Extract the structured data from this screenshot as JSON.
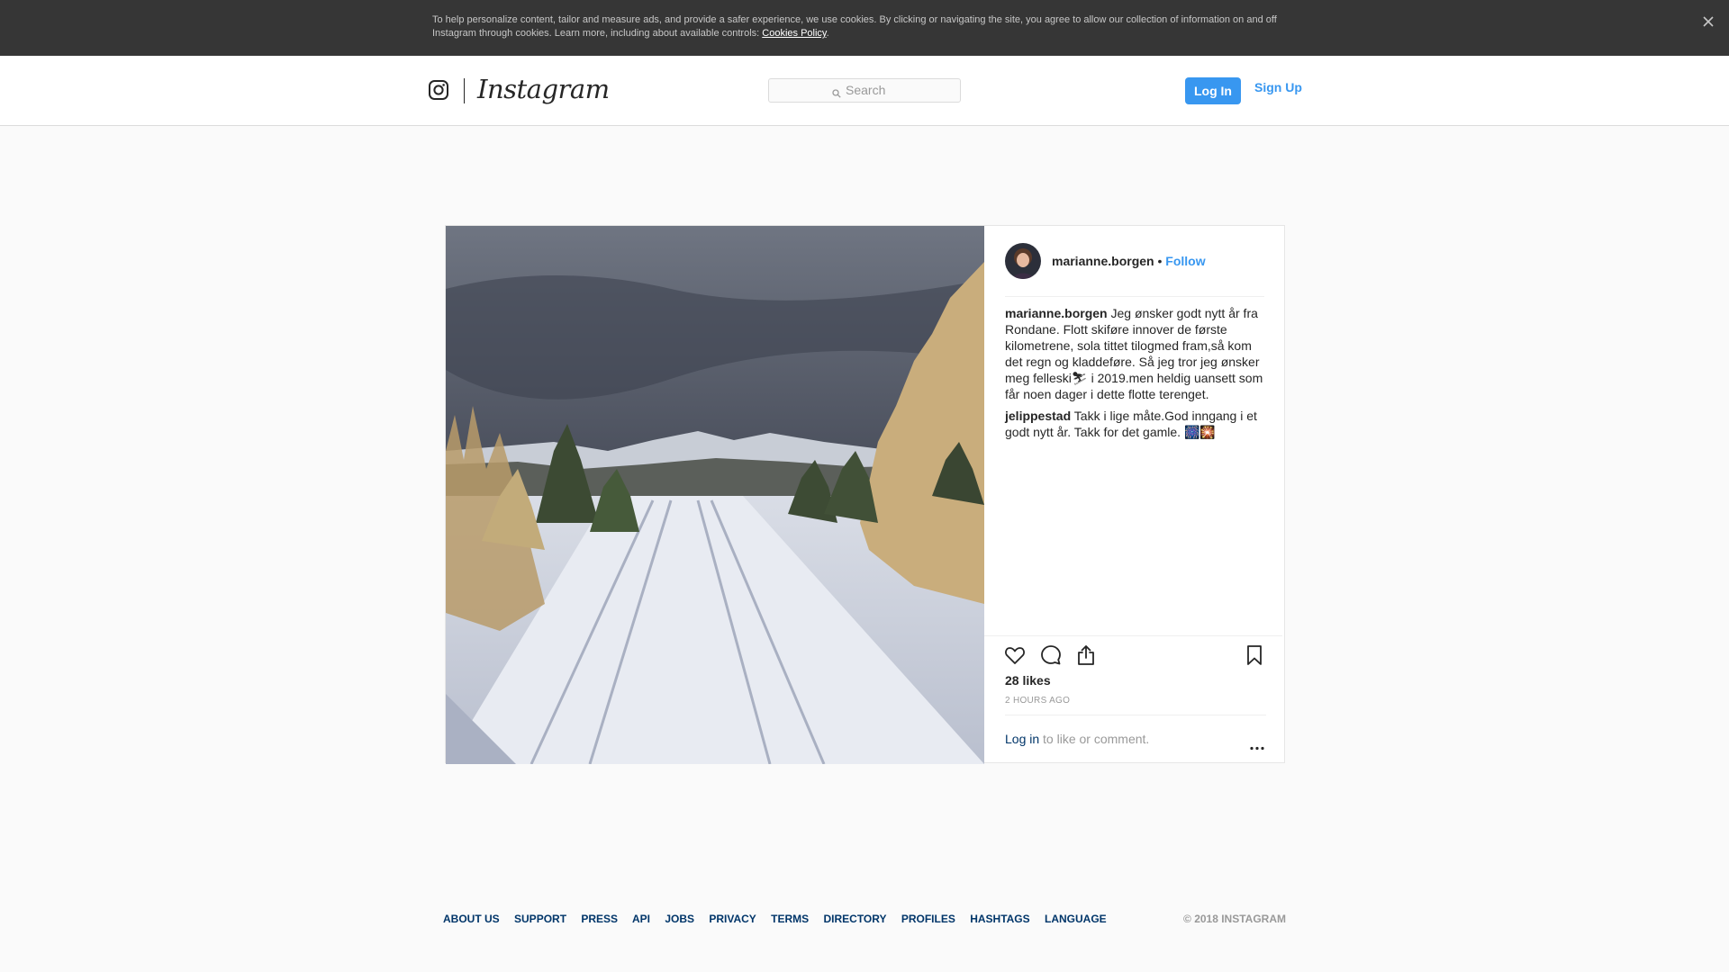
{
  "cookie_banner": {
    "text": "To help personalize content, tailor and measure ads, and provide a safer experience, we use cookies. By clicking or navigating the site, you agree to allow our collection of information on and off Instagram through cookies. Learn more, including about available controls: ",
    "link": "Cookies Policy",
    "suffix": ".",
    "close_icon": "close-icon"
  },
  "nav": {
    "logo_glyph": "instagram-glyph-icon",
    "wordmark": "Instagram",
    "search_placeholder": "Search",
    "login_label": "Log In",
    "signup_label": "Sign Up"
  },
  "post": {
    "photo_icon": "snowy-ski-trail-photo",
    "author": "marianne.borgen",
    "dot": "•",
    "follow_label": "Follow",
    "comments": [
      {
        "user": "marianne.borgen",
        "text": "Jeg ønsker godt nytt år fra Rondane. Flott skiføre innover de første kilometrene, sola tittet tilogmed fram,så kom det regn og kladdeføre. Så jeg tror jeg ønsker meg felleski⛷ i 2019.men heldig uansett som får noen dager i dette flotte terenget."
      },
      {
        "user": "jelippestad",
        "text": "Takk i lige måte.God inngang i et godt nytt år. Takk for det gamle. 🎆🎇"
      }
    ],
    "likes": "28 likes",
    "time": "2 HOURS AGO",
    "login_prompt_link": "Log in",
    "login_prompt_text": " to like or comment.",
    "icons": [
      "heart-icon",
      "comment-icon",
      "share-icon",
      "bookmark-icon",
      "more-icon"
    ]
  },
  "footer": {
    "links": [
      "ABOUT US",
      "SUPPORT",
      "PRESS",
      "API",
      "JOBS",
      "PRIVACY",
      "TERMS",
      "DIRECTORY",
      "PROFILES",
      "HASHTAGS",
      "LANGUAGE"
    ],
    "copyright": "© 2018 INSTAGRAM"
  },
  "colors": {
    "accent": "#3897f0",
    "link_dark": "#003569",
    "banner_bg": "#363636",
    "page_bg": "#fafafa"
  }
}
